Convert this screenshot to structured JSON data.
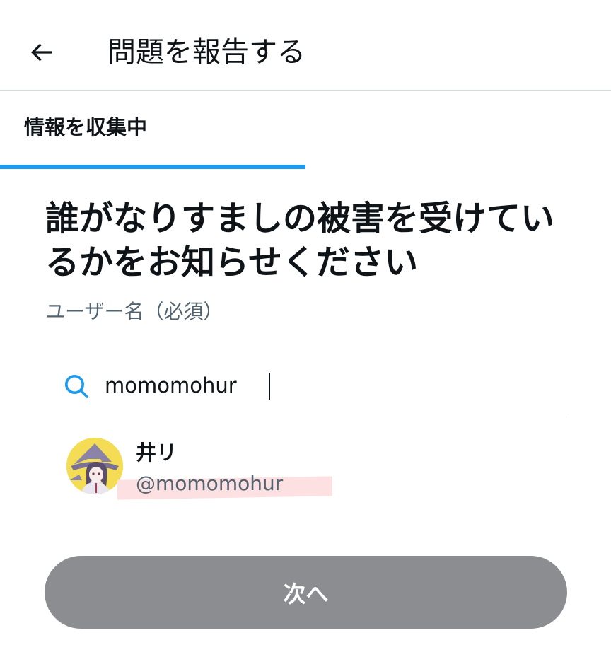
{
  "header": {
    "title": "問題を報告する",
    "back_icon": "arrow-left-icon"
  },
  "progress": {
    "label": "情報を収集中",
    "value": 0.5,
    "color": "#1d9bf0"
  },
  "question": {
    "title": "誰がなりすましの被害を受けているかをお知らせください",
    "field_label": "ユーザー名（必須）"
  },
  "search": {
    "icon": "search-icon",
    "value": "momomohur"
  },
  "results": [
    {
      "name": "井リ",
      "handle": "@momomohur"
    }
  ],
  "next_button": {
    "label": "次へ",
    "color": "#8b8d91"
  }
}
